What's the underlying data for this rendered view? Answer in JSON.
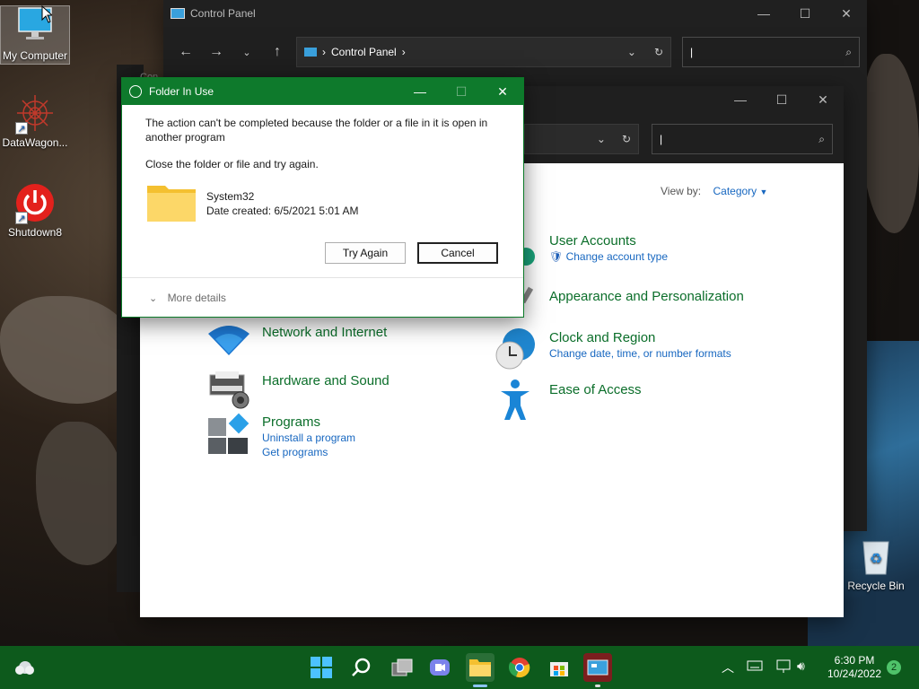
{
  "desktop": {
    "icons": [
      {
        "label": "My Computer"
      },
      {
        "label": "DataWagon..."
      },
      {
        "label": "Shutdown8"
      },
      {
        "label": "Recycle Bin"
      }
    ]
  },
  "cp_back": {
    "title": "Control Panel",
    "breadcrumb": "Control Panel",
    "behind_tab_label": "Con"
  },
  "cp_front": {
    "view_by_label": "View by:",
    "view_by_value": "Category",
    "categories": [
      {
        "title": "Network and Internet",
        "links": []
      },
      {
        "title": "Hardware and Sound",
        "links": []
      },
      {
        "title": "Programs",
        "links": [
          "Uninstall a program",
          "Get programs"
        ]
      },
      {
        "title": "User Accounts",
        "links": [
          "Change account type"
        ]
      },
      {
        "title": "Appearance and Personalization",
        "links": []
      },
      {
        "title": "Clock and Region",
        "links": [
          "Change date, time, or number formats"
        ]
      },
      {
        "title": "Ease of Access",
        "links": []
      }
    ]
  },
  "dialog": {
    "title": "Folder In Use",
    "message": "The action can't be completed because the folder or a file in it is open in another program",
    "instruction": "Close the folder or file and try again.",
    "folder_name": "System32",
    "folder_date": "Date created: 6/5/2021 5:01 AM",
    "try_again": "Try Again",
    "cancel": "Cancel",
    "more_details": "More details"
  },
  "taskbar": {
    "time": "6:30 PM",
    "date": "10/24/2022",
    "notifications": "2"
  },
  "colors": {
    "taskbar": "#0d5a1c",
    "dialog_title": "#0e7a2c",
    "link": "#1767c0",
    "category": "#0b6e2a"
  }
}
